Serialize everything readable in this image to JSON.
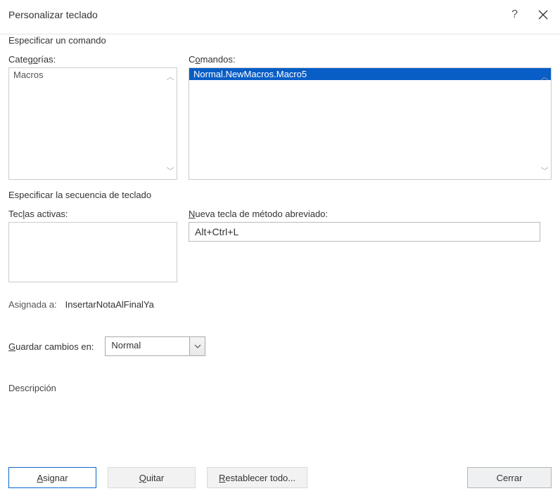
{
  "titlebar": {
    "title": "Personalizar teclado"
  },
  "section1": {
    "title": "Especificar un comando",
    "categories_label_pre": "Categ",
    "categories_label_u": "o",
    "categories_label_post": "rías:",
    "categories": [
      "Macros"
    ],
    "commands_label_pre": "C",
    "commands_label_u": "o",
    "commands_label_post": "mandos:",
    "commands": [
      "Normal.NewMacros.Macro5"
    ]
  },
  "section2": {
    "title": "Especificar la secuencia de teclado",
    "active_label_pre": "Tec",
    "active_label_u": "l",
    "active_label_post": "as activas:",
    "new_label_pre": "",
    "new_label_u": "N",
    "new_label_post": "ueva tecla de método abreviado:",
    "new_value": "Alt+Ctrl+L"
  },
  "assigned": {
    "label": "Asignada a:",
    "value": "InsertarNotaAlFinalYa"
  },
  "save": {
    "label_pre": "",
    "label_u": "G",
    "label_post": "uardar cambios en:",
    "value": "Normal"
  },
  "description": {
    "title": "Descripción"
  },
  "buttons": {
    "assign_pre": "",
    "assign_u": "A",
    "assign_post": "signar",
    "remove_pre": "",
    "remove_u": "Q",
    "remove_post": "uitar",
    "reset_pre": "",
    "reset_u": "R",
    "reset_post": "establecer todo...",
    "close": "Cerrar"
  }
}
